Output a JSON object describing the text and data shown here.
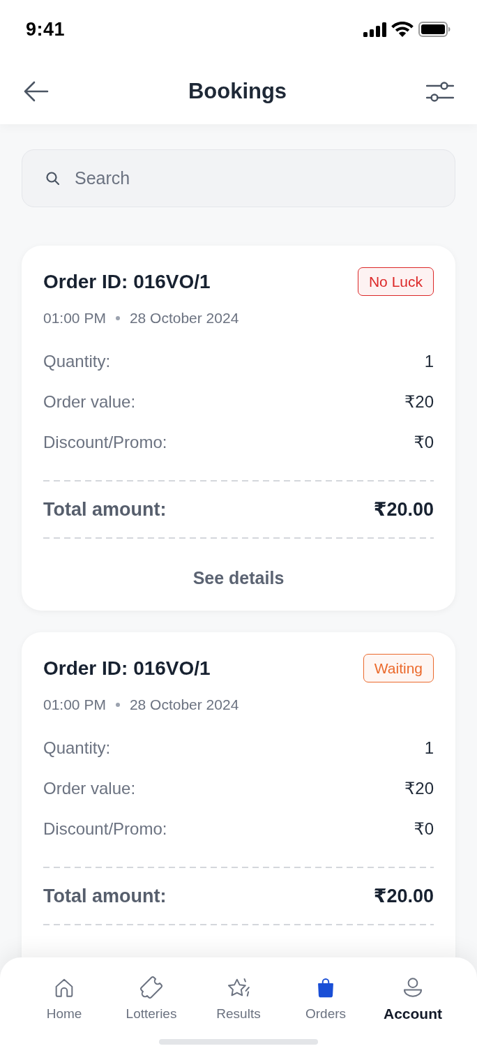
{
  "status_bar": {
    "time": "9:41"
  },
  "header": {
    "title": "Bookings"
  },
  "search": {
    "placeholder": "Search"
  },
  "orders": [
    {
      "title": "Order ID: 016VO/1",
      "badge": {
        "label": "No Luck",
        "color": "#dc2828"
      },
      "time": "01:00 PM",
      "date": "28 October 2024",
      "rows": [
        {
          "label": "Quantity:",
          "value": "1"
        },
        {
          "label": "Order value:",
          "value": "₹20"
        },
        {
          "label": "Discount/Promo:",
          "value": "₹0"
        }
      ],
      "total": {
        "label": "Total amount:",
        "value": "₹20.00"
      },
      "link": "See details"
    },
    {
      "title": "Order ID: 016VO/1",
      "badge": {
        "label": "Waiting",
        "color": "#eb6a2c"
      },
      "time": "01:00 PM",
      "date": "28 October 2024",
      "rows": [
        {
          "label": "Quantity:",
          "value": "1"
        },
        {
          "label": "Order value:",
          "value": "₹20"
        },
        {
          "label": "Discount/Promo:",
          "value": "₹0"
        }
      ],
      "total": {
        "label": "Total amount:",
        "value": "₹20.00"
      }
    }
  ],
  "tabs": [
    {
      "label": "Home",
      "selected": false,
      "emphasized": false
    },
    {
      "label": "Lotteries",
      "selected": false,
      "emphasized": false
    },
    {
      "label": "Results",
      "selected": false,
      "emphasized": false
    },
    {
      "label": "Orders",
      "selected": true,
      "emphasized": false
    },
    {
      "label": "Account",
      "selected": false,
      "emphasized": true
    }
  ]
}
